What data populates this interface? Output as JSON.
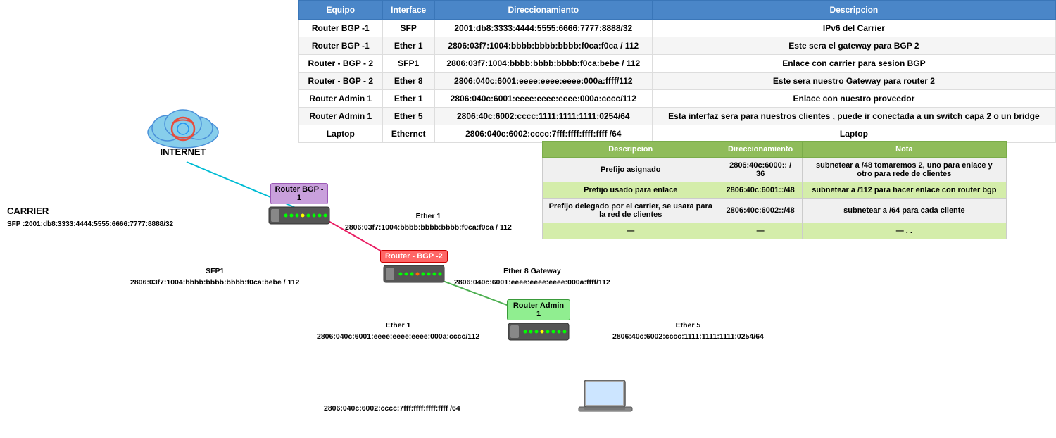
{
  "table": {
    "headers": [
      "Equipo",
      "Interface",
      "Direccionamiento",
      "Descripcion"
    ],
    "rows": [
      {
        "equipo": "Router BGP -1",
        "interface": "SFP",
        "direccionamiento": "2001:db8:3333:4444:5555:6666:7777:8888/32",
        "descripcion": "IPv6 del Carrier"
      },
      {
        "equipo": "Router BGP -1",
        "interface": "Ether 1",
        "direccionamiento": "2806:03f7:1004:bbbb:bbbb:bbbb:f0ca:f0ca / 112",
        "descripcion": "Este sera el gateway para BGP 2"
      },
      {
        "equipo": "Router - BGP - 2",
        "interface": "SFP1",
        "direccionamiento": "2806:03f7:1004:bbbb:bbbb:bbbb:f0ca:bebe / 112",
        "descripcion": "Enlace con carrier para sesion BGP"
      },
      {
        "equipo": "Router - BGP - 2",
        "interface": "Ether 8",
        "direccionamiento": "2806:040c:6001:eeee:eeee:eeee:000a:ffff/112",
        "descripcion": "Este sera nuestro Gateway para router 2"
      },
      {
        "equipo": "Router Admin 1",
        "interface": "Ether 1",
        "direccionamiento": "2806:040c:6001:eeee:eeee:eeee:000a:cccc/112",
        "descripcion": "Enlace con nuestro proveedor"
      },
      {
        "equipo": "Router Admin 1",
        "interface": "Ether 5",
        "direccionamiento": "2806:40c:6002:cccc:1111:1111:1111:0254/64",
        "descripcion": "Esta interfaz sera para nuestros clientes , puede ir conectada a un switch capa 2 o un bridge"
      },
      {
        "equipo": "Laptop",
        "interface": "Ethernet",
        "direccionamiento": "2806:040c:6002:cccc:7fff:ffff:ffff:ffff /64",
        "descripcion": "Laptop"
      }
    ]
  },
  "info_table": {
    "headers": [
      "Descripcion",
      "Direccionamiento",
      "Nota"
    ],
    "rows": [
      {
        "descripcion": "Prefijo asignado",
        "direccionamiento": "2806:40c:6000:: / 36",
        "nota": "subnetear a /48  tomaremos 2, uno para enlace y otro para rede de clientes"
      },
      {
        "descripcion": "Prefijo usado para enlace",
        "direccionamiento": "2806:40c:6001::/48",
        "nota": "subnetear a /112 para hacer enlace con router bgp"
      },
      {
        "descripcion": "Prefijo delegado por el carrier, se usara para la red de clientes",
        "direccionamiento": "2806:40c:6002::/48",
        "nota": "subnetear a /64 para cada cliente"
      },
      {
        "descripcion": "—",
        "direccionamiento": "—",
        "nota": "— . ."
      }
    ]
  },
  "diagram": {
    "internet_label": "INTERNET",
    "carrier_label": "CARRIER",
    "carrier_sfp": "SFP :2001:db8:3333:4444:5555:6666:7777:8888/32",
    "router_bgp1_label": "Router BGP -\n1",
    "router_bgp1_ether1": "Ether 1",
    "router_bgp1_ether1_addr": "2806:03f7:1004:bbbb:bbbb:bbbb:f0ca:f0ca / 112",
    "router_bgp2_label": "Router - BGP -2",
    "router_bgp2_sfp1": "SFP1",
    "router_bgp2_sfp1_addr": "2806:03f7:1004:bbbb:bbbb:bbbb:f0ca:bebe / 112",
    "router_bgp2_ether8": "Ether 8 Gateway",
    "router_bgp2_ether8_addr": "2806:040c:6001:eeee:eeee:eeee:000a:ffff/112",
    "router_admin1_label": "Router Admin 1",
    "router_admin1_ether1": "Ether 1",
    "router_admin1_ether1_addr": "2806:040c:6001:eeee:eeee:eeee:000a:cccc/112",
    "router_admin1_ether5": "Ether 5",
    "router_admin1_ether5_addr": "2806:40c:6002:cccc:1111:1111:1111:0254/64",
    "laptop_addr": "2806:040c:6002:cccc:7fff:ffff:ffff:ffff /64"
  }
}
